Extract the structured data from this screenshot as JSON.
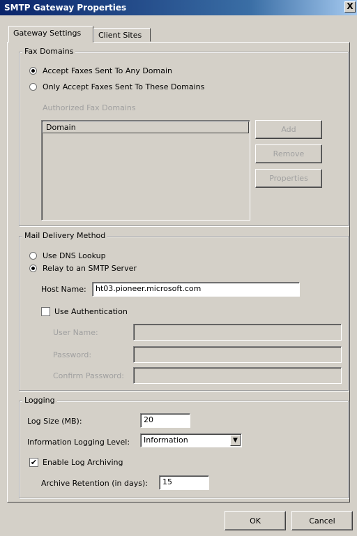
{
  "window": {
    "title": "SMTP Gateway Properties",
    "close_glyph": "X"
  },
  "tabs": [
    {
      "label": "Gateway Settings",
      "active": true
    },
    {
      "label": "Client Sites",
      "active": false
    }
  ],
  "fax_domains": {
    "legend": "Fax Domains",
    "options": [
      {
        "label": "Accept Faxes Sent To Any Domain",
        "selected": true
      },
      {
        "label": "Only Accept Faxes Sent To These Domains",
        "selected": false
      }
    ],
    "authorized_label": "Authorized Fax Domains",
    "list_column": "Domain",
    "buttons": {
      "add": "Add",
      "remove": "Remove",
      "properties": "Properties"
    }
  },
  "mail_delivery": {
    "legend": "Mail Delivery Method",
    "options": [
      {
        "label": "Use DNS Lookup",
        "selected": false
      },
      {
        "label": "Relay to an SMTP Server",
        "selected": true
      }
    ],
    "host_label": "Host Name:",
    "host_value": "ht03.pioneer.microsoft.com",
    "use_auth_label": "Use Authentication",
    "use_auth_checked": false,
    "user_name_label": "User Name:",
    "password_label": "Password:",
    "confirm_label": "Confirm Password:"
  },
  "logging": {
    "legend": "Logging",
    "log_size_label": "Log Size (MB):",
    "log_size_value": "20",
    "level_label": "Information Logging Level:",
    "level_value": "Information",
    "archiving_label": "Enable Log Archiving",
    "archiving_checked": true,
    "check_glyph": "✔",
    "retention_label": "Archive Retention (in days):",
    "retention_value": "15"
  },
  "footer": {
    "ok": "OK",
    "cancel": "Cancel"
  }
}
